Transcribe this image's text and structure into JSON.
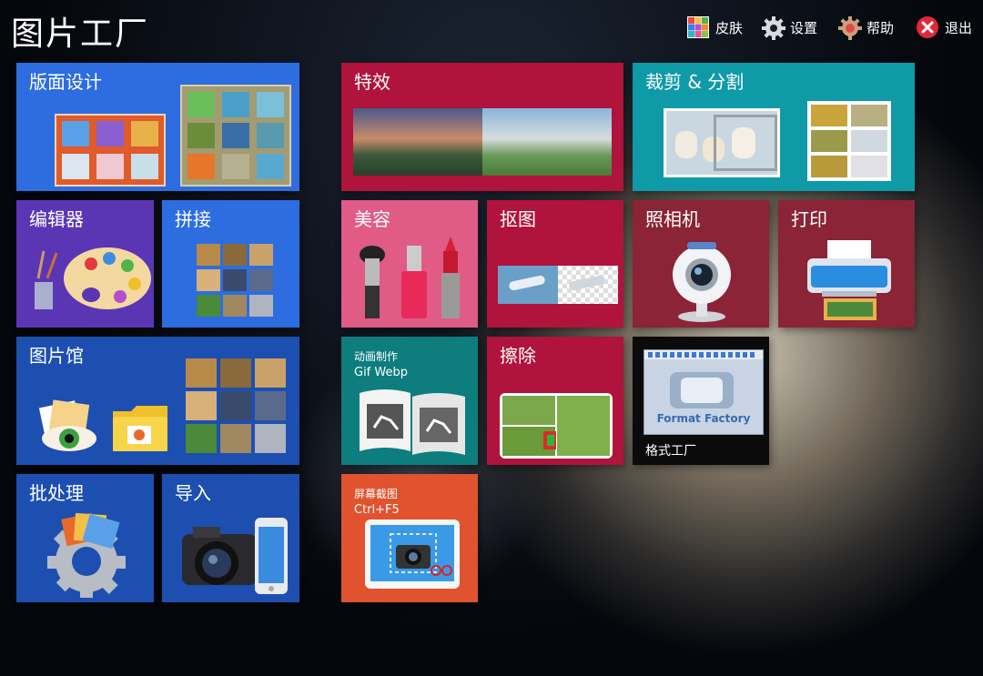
{
  "app": {
    "title": "图片工厂"
  },
  "toolbar": {
    "skin": "皮肤",
    "settings": "设置",
    "help": "帮助",
    "exit": "退出"
  },
  "tiles": {
    "layout": "版面设计",
    "effects": "特效",
    "crop": "裁剪 & 分割",
    "editor": "编辑器",
    "collage": "拼接",
    "beauty": "美容",
    "cutout": "抠图",
    "camera": "照相机",
    "print": "打印",
    "gallery": "图片馆",
    "animation_line1": "动画制作",
    "animation_line2": "Gif Webp",
    "erase": "擦除",
    "format_factory": "格式工厂",
    "format_factory_logo": "Format Factory",
    "batch": "批处理",
    "import": "导入",
    "screenshot_line1": "屏幕截图",
    "screenshot_line2": "Ctrl+F5"
  },
  "colors": {
    "blue": "#2d6de0",
    "deep_blue": "#1d4fb0",
    "purple": "#5a36b5",
    "crimson": "#b0133b",
    "teal": "#0f9aa8",
    "pink": "#e05b86",
    "maroon": "#8a2436",
    "dark_teal": "#0d7d7e",
    "orange": "#e0532e",
    "black": "#0b0b0b"
  }
}
